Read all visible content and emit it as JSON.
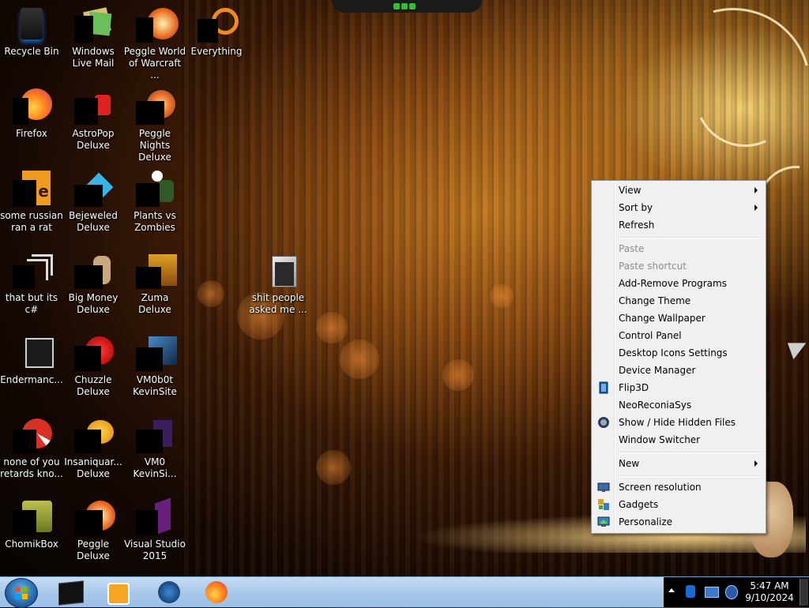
{
  "desktop_icons": [
    {
      "name": "recycle-bin",
      "label": "Recycle Bin"
    },
    {
      "name": "windows-live-mail",
      "label": "Windows Live Mail"
    },
    {
      "name": "peggle-world-of-warcraft",
      "label": "Peggle World of Warcraft ..."
    },
    {
      "name": "everything",
      "label": "Everything"
    },
    {
      "name": "firefox",
      "label": "Firefox"
    },
    {
      "name": "astropop-deluxe",
      "label": "AstroPop Deluxe"
    },
    {
      "name": "peggle-nights-deluxe",
      "label": "Peggle Nights Deluxe"
    },
    {
      "name": "some-russian-ran-a-rat",
      "label": "some russian ran a rat"
    },
    {
      "name": "bejeweled-deluxe",
      "label": "Bejeweled Deluxe"
    },
    {
      "name": "plants-vs-zombies",
      "label": "Plants vs Zombies"
    },
    {
      "name": "that-but-its-c",
      "label": "that but its c#"
    },
    {
      "name": "big-money-deluxe",
      "label": "Big Money Deluxe"
    },
    {
      "name": "zuma-deluxe",
      "label": "Zuma Deluxe"
    },
    {
      "name": "shit-people-asked-me",
      "label": "shit people asked me ..."
    },
    {
      "name": "endermanc",
      "label": "Endermanc..."
    },
    {
      "name": "chuzzle-deluxe",
      "label": "Chuzzle Deluxe"
    },
    {
      "name": "vm0b0t-kevinsite",
      "label": "VM0b0t KevinSite"
    },
    {
      "name": "none-of-you-retards",
      "label": "none of you retards kno..."
    },
    {
      "name": "insaniquarium-deluxe",
      "label": "Insaniquar... Deluxe"
    },
    {
      "name": "vm0-kevinsi",
      "label": "VM0 KevinSi..."
    },
    {
      "name": "chomikbox",
      "label": "ChomikBox"
    },
    {
      "name": "peggle-deluxe",
      "label": "Peggle Deluxe"
    },
    {
      "name": "visual-studio-2015",
      "label": "Visual Studio 2015"
    }
  ],
  "context_menu": {
    "items": [
      {
        "label": "View",
        "submenu": true,
        "disabled": false
      },
      {
        "label": "Sort by",
        "submenu": true,
        "disabled": false
      },
      {
        "label": "Refresh",
        "submenu": false,
        "disabled": false
      },
      {
        "label": "Paste",
        "submenu": false,
        "disabled": true
      },
      {
        "label": "Paste shortcut",
        "submenu": false,
        "disabled": true
      },
      {
        "label": "Add-Remove Programs",
        "submenu": false,
        "disabled": false
      },
      {
        "label": "Change Theme",
        "submenu": false,
        "disabled": false
      },
      {
        "label": "Change Wallpaper",
        "submenu": false,
        "disabled": false
      },
      {
        "label": "Control Panel",
        "submenu": false,
        "disabled": false
      },
      {
        "label": "Desktop Icons Settings",
        "submenu": false,
        "disabled": false
      },
      {
        "label": "Device Manager",
        "submenu": false,
        "disabled": false
      },
      {
        "label": "Flip3D",
        "submenu": false,
        "disabled": false,
        "icon": "flip3d-icon"
      },
      {
        "label": "NeoReconiaSys",
        "submenu": false,
        "disabled": false
      },
      {
        "label": "Show / Hide Hidden Files",
        "submenu": false,
        "disabled": false,
        "icon": "hidden-files-icon"
      },
      {
        "label": "Window Switcher",
        "submenu": false,
        "disabled": false
      },
      {
        "label": "New",
        "submenu": true,
        "disabled": false
      },
      {
        "label": "Screen resolution",
        "submenu": false,
        "disabled": false,
        "icon": "screen-resolution-icon"
      },
      {
        "label": "Gadgets",
        "submenu": false,
        "disabled": false,
        "icon": "gadgets-icon"
      },
      {
        "label": "Personalize",
        "submenu": false,
        "disabled": false,
        "icon": "personalize-icon"
      }
    ]
  },
  "taskbar": {
    "pinned": [
      "terminal-icon",
      "media-player-icon",
      "globe-icon",
      "firefox-icon"
    ],
    "tray_icons": [
      "show-hidden-icons-arrow",
      "bluetooth-icon",
      "network-icon",
      "volume-icon"
    ],
    "time": "5:47 AM",
    "date": "9/10/2024"
  },
  "colors": {
    "menu_bg": "#f0f0f0",
    "taskbar": "#a9c8ea",
    "accent_glow": "#ffb040"
  }
}
